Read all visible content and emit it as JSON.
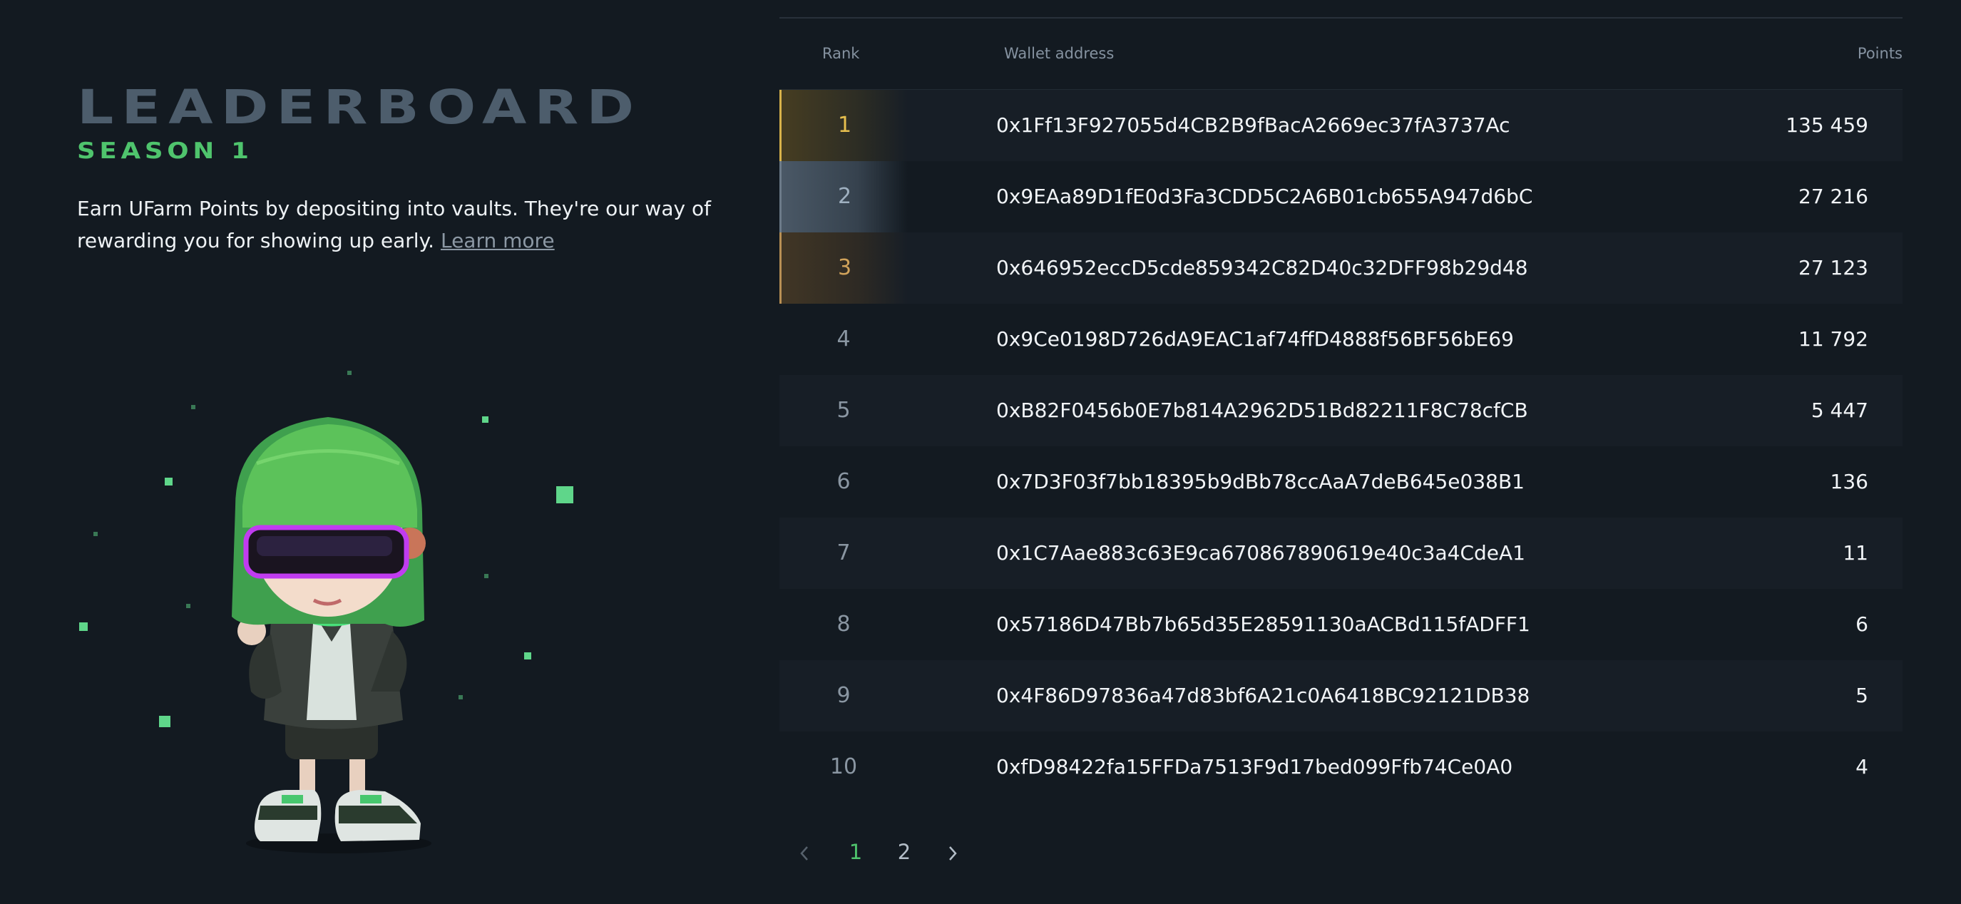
{
  "header": {
    "title": "LEADERBOARD",
    "season": "SEASON 1",
    "description": "Earn UFarm Points by depositing into vaults. They're our way of rewarding you for showing up early.",
    "learn_more": "Learn more"
  },
  "table": {
    "columns": {
      "rank": "Rank",
      "wallet": "Wallet address",
      "points": "Points"
    },
    "rows": [
      {
        "rank": "1",
        "wallet": "0x1Ff13F927055d4CB2B9fBacA2669ec37fA3737Ac",
        "points": "135 459"
      },
      {
        "rank": "2",
        "wallet": "0x9EAa89D1fE0d3Fa3CDD5C2A6B01cb655A947d6bC",
        "points": "27 216"
      },
      {
        "rank": "3",
        "wallet": "0x646952eccD5cde859342C82D40c32DFF98b29d48",
        "points": "27 123"
      },
      {
        "rank": "4",
        "wallet": "0x9Ce0198D726dA9EAC1af74ffD4888f56BF56bE69",
        "points": "11 792"
      },
      {
        "rank": "5",
        "wallet": "0xB82F0456b0E7b814A2962D51Bd82211F8C78cfCB",
        "points": "5 447"
      },
      {
        "rank": "6",
        "wallet": "0x7D3F03f7bb18395b9dBb78ccAaA7deB645e038B1",
        "points": "136"
      },
      {
        "rank": "7",
        "wallet": "0x1C7Aae883c63E9ca670867890619e40c3a4CdeA1",
        "points": "11"
      },
      {
        "rank": "8",
        "wallet": "0x57186D47Bb7b65d35E28591130aACBd115fADFF1",
        "points": "6"
      },
      {
        "rank": "9",
        "wallet": "0x4F86D97836a47d83bf6A21c0A6418BC92121DB38",
        "points": "5"
      },
      {
        "rank": "10",
        "wallet": "0xfD98422fa15FFDa7513F9d17bed099Ffb74Ce0A0",
        "points": "4"
      }
    ]
  },
  "pagination": {
    "prev_icon": "chevron-left-icon",
    "pages": [
      "1",
      "2"
    ],
    "current": "1",
    "next_icon": "chevron-right-icon"
  },
  "colors": {
    "background": "#131a21",
    "accent_green": "#4fc46d",
    "gold": "#e7bf4e",
    "silver": "#9fb0c0",
    "bronze": "#d0a25a"
  }
}
